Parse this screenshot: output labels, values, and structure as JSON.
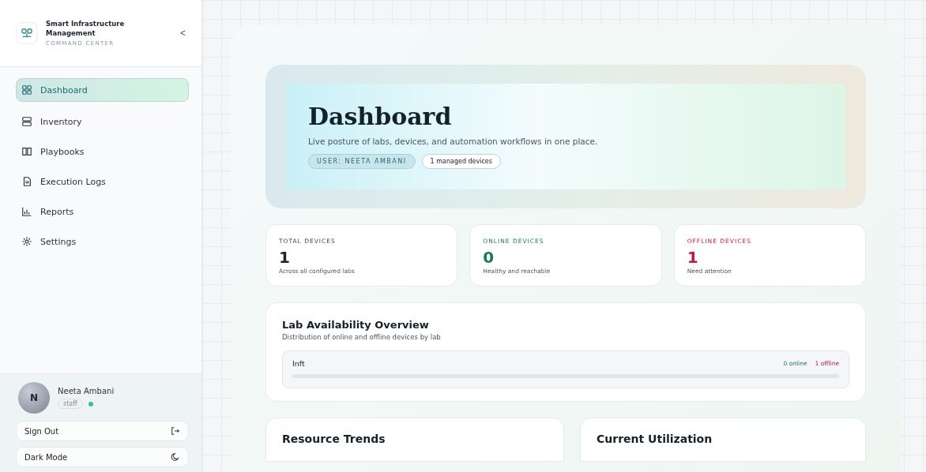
{
  "sidebar": {
    "brand": {
      "title": "Smart Infrastructure Management",
      "subtitle": "COMMAND CENTER",
      "collapse": "<"
    },
    "items": [
      {
        "label": "Dashboard",
        "kind": "grid",
        "selected": true
      },
      {
        "label": "Inventory",
        "kind": "server",
        "selected": false
      },
      {
        "label": "Playbooks",
        "kind": "book",
        "selected": false
      },
      {
        "label": "Execution Logs",
        "kind": "file",
        "selected": false
      },
      {
        "label": "Reports",
        "kind": "chart",
        "selected": false
      },
      {
        "label": "Settings",
        "kind": "gear",
        "selected": false
      }
    ],
    "user": {
      "initial": "N",
      "name": "Neeta Ambani",
      "role": "staff",
      "online": true
    },
    "actions": [
      {
        "label": "Sign Out",
        "kind": "signout"
      },
      {
        "label": "Dark Mode",
        "kind": "moon"
      }
    ]
  },
  "hero": {
    "title": "Dashboard",
    "subtitle": "Live posture of labs, devices, and automation workflows in one place.",
    "user_chip": "USER: NEETA AMBANI",
    "devices_chip": "1 managed devices"
  },
  "stats": [
    {
      "kind": "total",
      "label": "TOTAL DEVICES",
      "value": "1",
      "note": "Across all configured labs"
    },
    {
      "kind": "online",
      "label": "ONLINE DEVICES",
      "value": "0",
      "note": "Healthy and reachable"
    },
    {
      "kind": "offline",
      "label": "OFFLINE DEVICES",
      "value": "1",
      "note": "Need attention"
    }
  ],
  "lab_overview": {
    "title": "Lab Availability Overview",
    "subtitle": "Distribution of online and offline devices by lab",
    "labs": [
      {
        "name": "Inft",
        "online": "0 online",
        "offline": "1 offline"
      }
    ]
  },
  "bottom_cards": [
    {
      "title": "Resource Trends"
    },
    {
      "title": "Current Utilization"
    }
  ]
}
